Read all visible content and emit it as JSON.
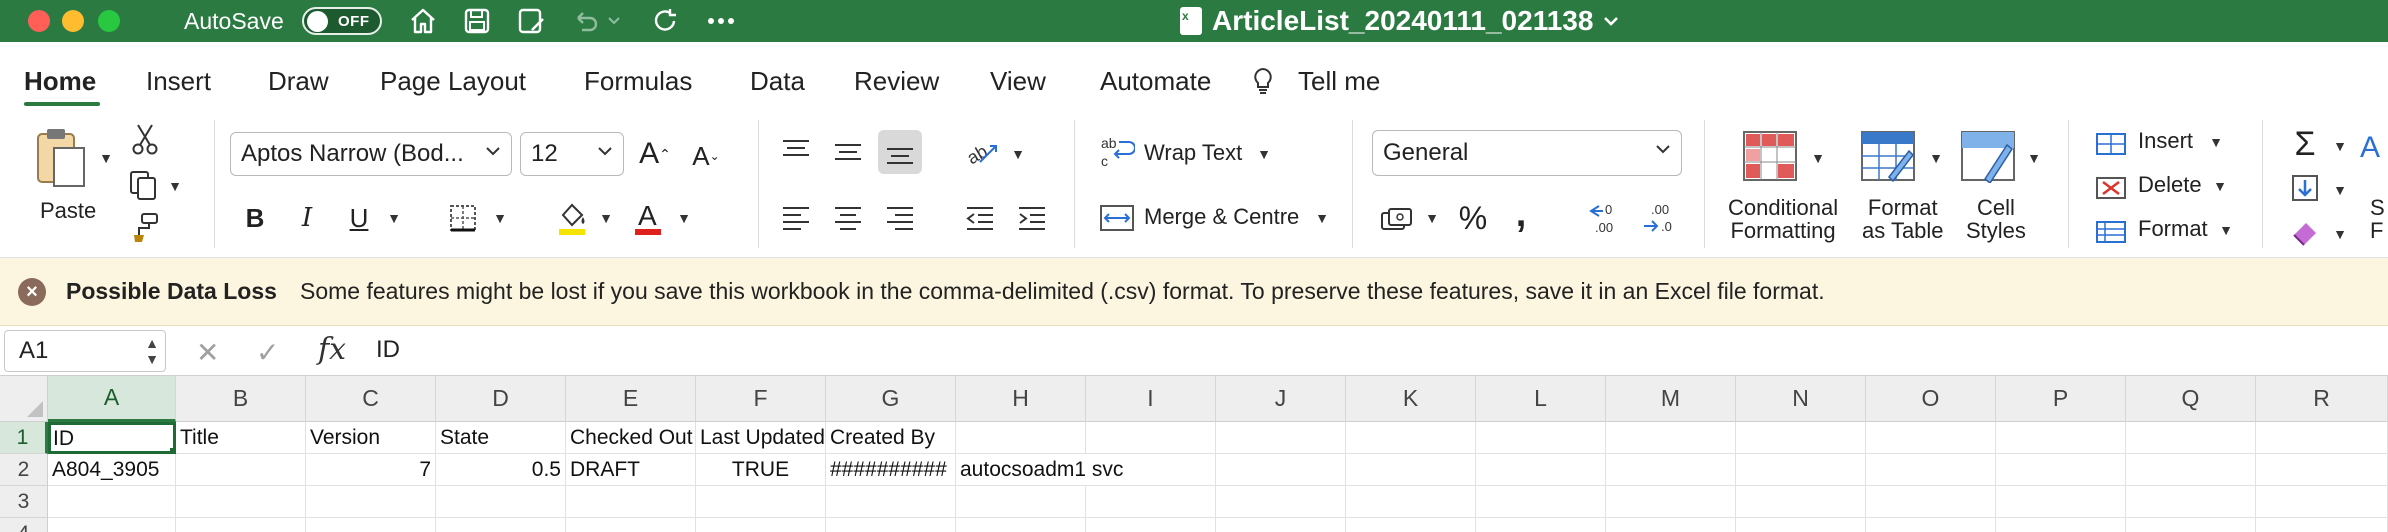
{
  "titlebar": {
    "autosave_label": "AutoSave",
    "autosave_state": "OFF",
    "document_title": "ArticleList_20240111_021138"
  },
  "tabs": [
    "Home",
    "Insert",
    "Draw",
    "Page Layout",
    "Formulas",
    "Data",
    "Review",
    "View",
    "Automate",
    "Tell me"
  ],
  "ribbon": {
    "paste_label": "Paste",
    "font_name": "Aptos Narrow (Bod...",
    "font_size": "12",
    "bold": "B",
    "italic": "I",
    "underline": "U",
    "wrap_text": "Wrap Text",
    "merge_centre": "Merge & Centre",
    "number_format": "General",
    "percent": "%",
    "comma": ",",
    "conditional_formatting": "Conditional\nFormatting",
    "format_as_table": "Format\nas Table",
    "cell_styles": "Cell\nStyles",
    "insert": "Insert",
    "delete": "Delete",
    "format": "Format",
    "cut_off_label": "S\nF"
  },
  "message_bar": {
    "title": "Possible Data Loss",
    "text": "Some features might be lost if you save this workbook in the comma-delimited (.csv) format. To preserve these features, save it in an Excel file format."
  },
  "formula_bar": {
    "name_box": "A1",
    "fx": "fx",
    "value": "ID"
  },
  "grid": {
    "columns": [
      "A",
      "B",
      "C",
      "D",
      "E",
      "F",
      "G",
      "H",
      "I",
      "J",
      "K",
      "L",
      "M",
      "N",
      "O",
      "P",
      "Q",
      "R"
    ],
    "rows": [
      "1",
      "2",
      "3",
      "4"
    ],
    "row1": [
      "ID",
      "Title",
      "Version",
      "State",
      "Checked Out",
      "Last Updated",
      "Created By",
      "",
      "",
      "",
      "",
      "",
      "",
      "",
      "",
      "",
      "",
      ""
    ],
    "row2": [
      "A804_3905",
      "",
      "7",
      "0.5",
      "DRAFT",
      "TRUE",
      "##########",
      "autocsoadm1 svc",
      "",
      "",
      "",
      "",
      "",
      "",
      "",
      "",
      "",
      ""
    ]
  },
  "colors": {
    "title_bar": "#2b7a42",
    "message_bar": "#fcf5e0",
    "selection": "#1e6b35"
  }
}
